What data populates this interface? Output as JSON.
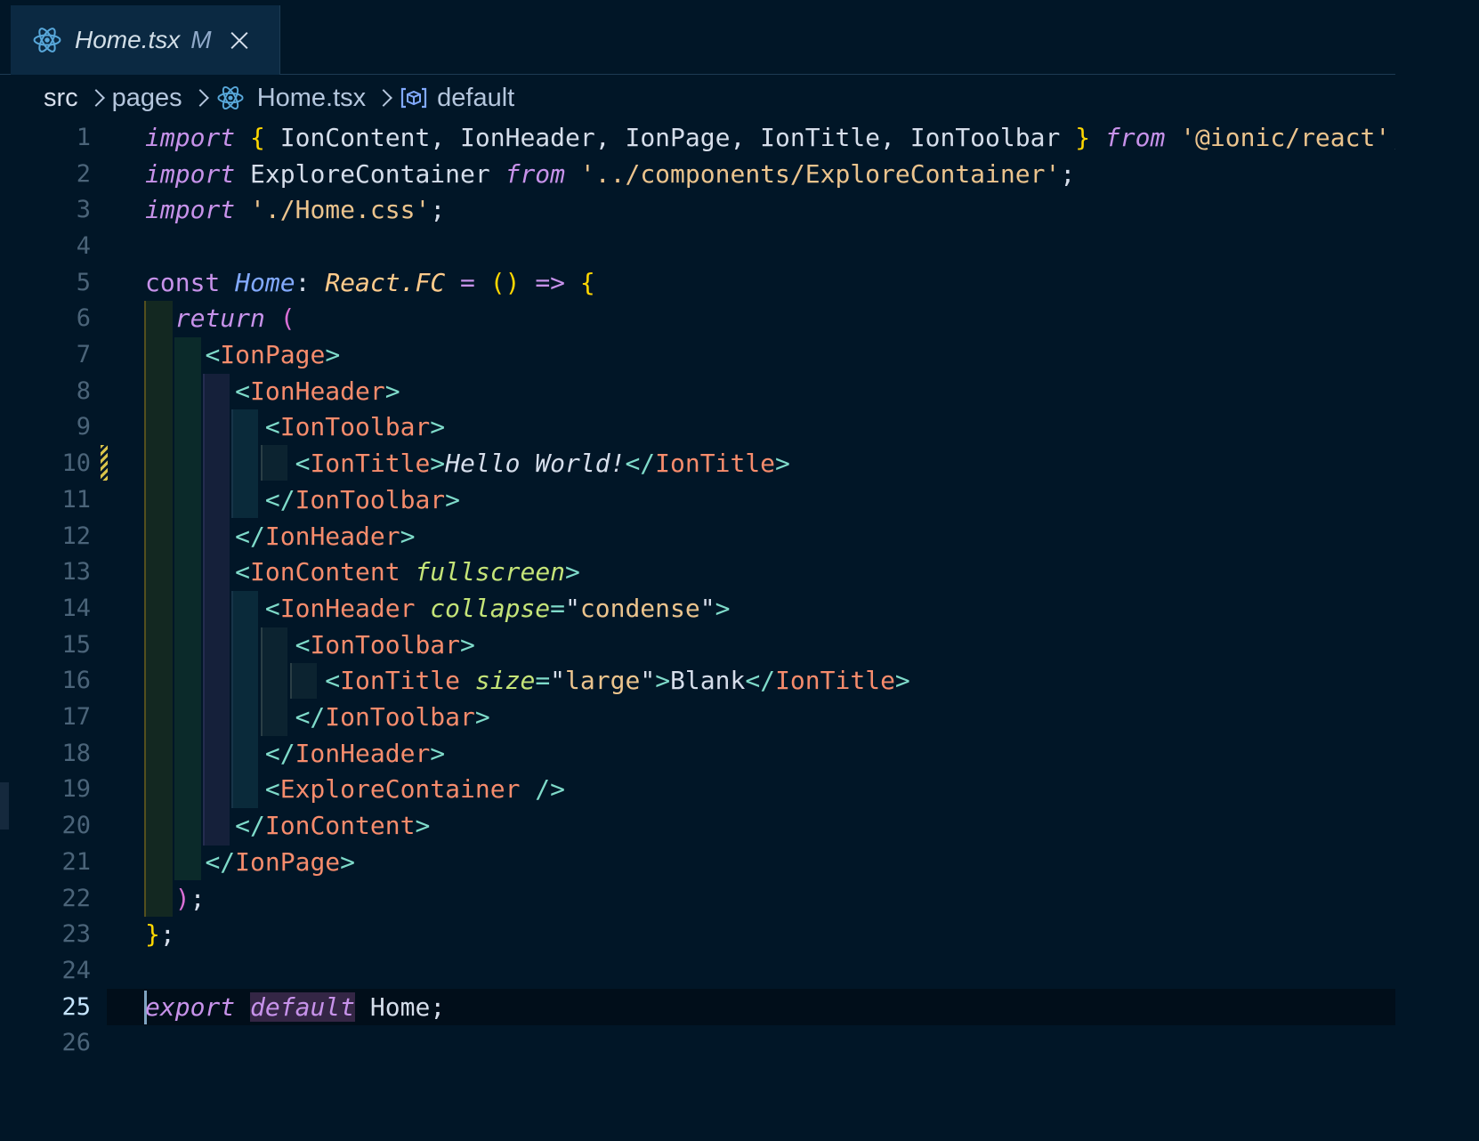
{
  "tab": {
    "file_name": "Home.tsx",
    "status": "M",
    "icon": "react-icon",
    "close_icon": "close-icon"
  },
  "breadcrumb": {
    "items": [
      "src",
      "pages",
      "Home.tsx",
      "default"
    ],
    "file_icon": "react-icon",
    "symbol_icon": "symbol-variable-icon"
  },
  "editor": {
    "active_line": 25,
    "modified_line": 10,
    "line_numbers": [
      "1",
      "2",
      "3",
      "4",
      "5",
      "6",
      "7",
      "8",
      "9",
      "10",
      "11",
      "12",
      "13",
      "14",
      "15",
      "16",
      "17",
      "18",
      "19",
      "20",
      "21",
      "22",
      "23",
      "24",
      "25",
      "26"
    ],
    "lines": [
      "import { IonContent, IonHeader, IonPage, IonTitle, IonToolbar } from '@ionic/react';",
      "import ExploreContainer from '../components/ExploreContainer';",
      "import './Home.css';",
      "",
      "const Home: React.FC = () => {",
      "  return (",
      "    <IonPage>",
      "      <IonHeader>",
      "        <IonToolbar>",
      "          <IonTitle>Hello World!</IonTitle>",
      "        </IonToolbar>",
      "      </IonHeader>",
      "      <IonContent fullscreen>",
      "        <IonHeader collapse=\"condense\">",
      "          <IonToolbar>",
      "            <IonTitle size=\"large\">Blank</IonTitle>",
      "          </IonToolbar>",
      "        </IonHeader>",
      "        <ExploreContainer />",
      "      </IonContent>",
      "    </IonPage>",
      "  );",
      "};",
      "",
      "export default Home;",
      ""
    ]
  },
  "colors": {
    "background": "#011627",
    "keyword": "#c792ea",
    "tag": "#f78c6c",
    "string": "#ecc48d",
    "attribute": "#c5e478",
    "bracket": "#ffd700",
    "function": "#82aaff",
    "type": "#ffcb8b",
    "punctuation": "#7fdbca"
  }
}
